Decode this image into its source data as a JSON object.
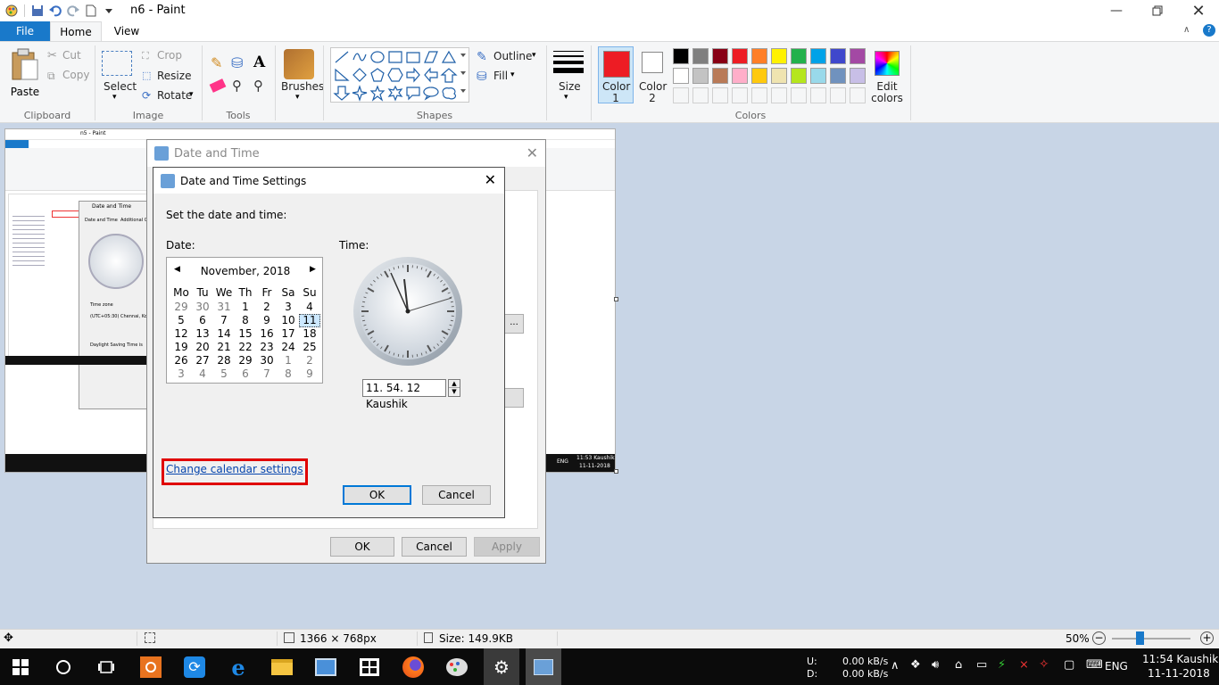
{
  "window": {
    "title": "n6 - Paint"
  },
  "tabs": {
    "file": "File",
    "home": "Home",
    "view": "View"
  },
  "ribbon": {
    "clipboard": {
      "paste": "Paste",
      "cut": "Cut",
      "copy": "Copy",
      "label": "Clipboard"
    },
    "image": {
      "select": "Select",
      "crop": "Crop",
      "resize": "Resize",
      "rotate": "Rotate",
      "label": "Image"
    },
    "tools": {
      "label": "Tools"
    },
    "brushes": {
      "label": "Brushes"
    },
    "shapes": {
      "outline": "Outline",
      "fill": "Fill",
      "label": "Shapes"
    },
    "size": {
      "label": "Size"
    },
    "colors": {
      "color1": "Color 1",
      "color2": "Color 2",
      "edit": "Edit colors",
      "label": "Colors",
      "color1_value": "#ed1c24",
      "color2_value": "#ffffff",
      "row1": [
        "#000000",
        "#7f7f7f",
        "#880015",
        "#ed1c24",
        "#ff7f27",
        "#fff200",
        "#22b14c",
        "#00a2e8",
        "#3f48cc",
        "#a349a4"
      ],
      "row2": [
        "#ffffff",
        "#c3c3c3",
        "#b97a57",
        "#ffaec9",
        "#ffc90e",
        "#efe4b0",
        "#b5e61d",
        "#99d9ea",
        "#7092be",
        "#c8bfe7"
      ]
    }
  },
  "outer_dialog": {
    "title": "Date and Time",
    "ok": "OK",
    "cancel": "Cancel",
    "apply": "Apply"
  },
  "dialog": {
    "title": "Date and Time Settings",
    "prompt": "Set the date and time:",
    "date_label": "Date:",
    "time_label": "Time:",
    "month": "November, 2018",
    "weekdays": [
      "Mo",
      "Tu",
      "We",
      "Th",
      "Fr",
      "Sa",
      "Su"
    ],
    "weeks": [
      [
        "29",
        "30",
        "31",
        "1",
        "2",
        "3",
        "4"
      ],
      [
        "5",
        "6",
        "7",
        "8",
        "9",
        "10",
        "11"
      ],
      [
        "12",
        "13",
        "14",
        "15",
        "16",
        "17",
        "18"
      ],
      [
        "19",
        "20",
        "21",
        "22",
        "23",
        "24",
        "25"
      ],
      [
        "26",
        "27",
        "28",
        "29",
        "30",
        "1",
        "2"
      ],
      [
        "3",
        "4",
        "5",
        "6",
        "7",
        "8",
        "9"
      ]
    ],
    "selected_day": "11",
    "time_value": "11. 54. 12 Kaushik",
    "change_link": "Change calendar settings",
    "ok": "OK",
    "cancel": "Cancel"
  },
  "inner_screenshot": {
    "title": "n5 - Paint",
    "dialog_title": "Date and Time",
    "tab1": "Date and Time",
    "tab2": "Additional Cl",
    "timezone_label": "Time zone",
    "timezone_value": "(UTC+05:30) Chennai, Ko",
    "dst": "Daylight Saving Time is",
    "clock_time": "11:53 Kaushik",
    "clock_date": "11-11-2018",
    "lang": "ENG"
  },
  "status": {
    "dimensions": "1366 × 768px",
    "size": "Size: 149.9KB",
    "zoom": "50%",
    "zoom_fraction": 0.5
  },
  "taskbar": {
    "net_up_label": "U:",
    "net_down_label": "D:",
    "net_up": "0.00 kB/s",
    "net_down": "0.00 kB/s",
    "lang": "ENG",
    "time": "11:54 Kaushik",
    "date": "11-11-2018"
  }
}
